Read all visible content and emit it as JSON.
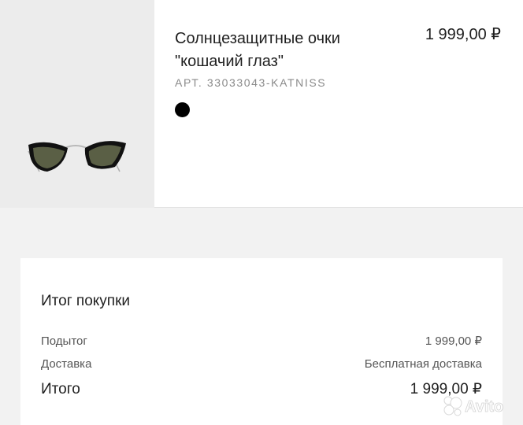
{
  "product": {
    "title": "Солнцезащитные очки \"кошачий глаз\"",
    "price": "1 999,00 ₽",
    "sku": "АРТ. 33033043-KATNISS",
    "color_swatch": "#000000"
  },
  "summary": {
    "title": "Итог покупки",
    "subtotal_label": "Подытог",
    "subtotal_value": "1 999,00 ₽",
    "delivery_label": "Доставка",
    "delivery_value": "Бесплатная доставка",
    "total_label": "Итого",
    "total_value": "1 999,00 ₽"
  },
  "watermark": {
    "text": "Avito"
  }
}
